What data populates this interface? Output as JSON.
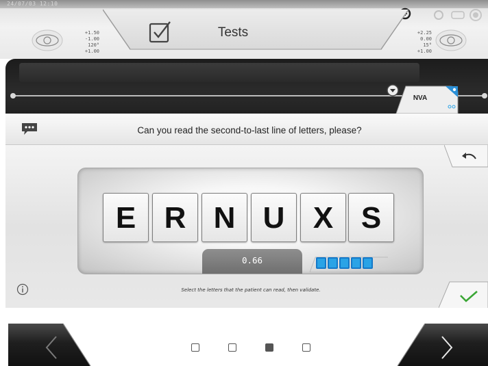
{
  "header": {
    "top_date": "24/07/03  12:10",
    "title": "Tests",
    "left_rx": [
      "+1.50",
      "-1.00",
      "120°",
      "+1.00"
    ],
    "right_rx": [
      "+2.25",
      "0.00",
      "15°",
      "+1.00"
    ]
  },
  "test_tab": {
    "label": "NVA"
  },
  "question": {
    "text": "Can you read the second-to-last line of letters, please?"
  },
  "chart": {
    "letters": [
      "E",
      "R",
      "N",
      "U",
      "X",
      "S"
    ],
    "acuity": "0.66",
    "progress_boxes": 5
  },
  "instruction": {
    "text": "Select the letters that the patient can read, then validate."
  },
  "pagination": {
    "pages": 4,
    "active_index": 2
  },
  "colors": {
    "accent_blue": "#2aa3e6",
    "validate_green": "#3aa635"
  },
  "icons": [
    "check-box-icon",
    "left-eye-icon",
    "right-eye-icon",
    "timer-icon",
    "power-icon",
    "chat-icon",
    "patient-icon",
    "back-arrow-icon",
    "info-icon",
    "validate-check-icon",
    "chevron-left-icon",
    "chevron-right-icon"
  ]
}
